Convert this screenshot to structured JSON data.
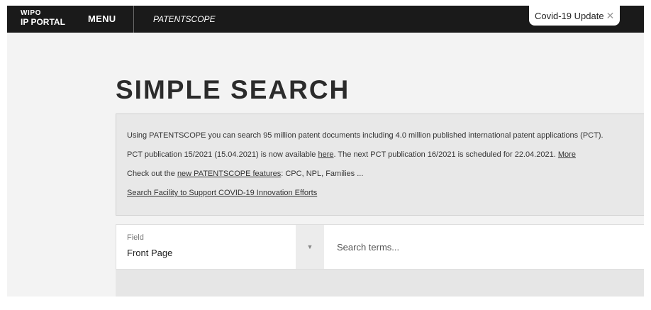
{
  "header": {
    "logo_line1": "WIPO",
    "logo_line2": "IP PORTAL",
    "menu_label": "MENU",
    "product_name": "PATENTSCOPE",
    "covid_label": "Covid-19 Update",
    "close_glyph": "✕"
  },
  "main": {
    "title": "SIMPLE SEARCH",
    "info": {
      "line1": "Using PATENTSCOPE you can search 95 million patent documents including 4.0 million published international patent applications (PCT).",
      "line2_prefix": "PCT publication 15/2021 (15.04.2021) is now available ",
      "line2_link": "here",
      "line2_suffix": ". The next PCT publication 16/2021 is scheduled for 22.04.2021. ",
      "line2_more": "More",
      "line3_prefix": "Check out the ",
      "line3_link": "new PATENTSCOPE features",
      "line3_suffix": ": CPC, NPL, Families ...",
      "line4_link": "Search Facility to Support COVID-19 Innovation Efforts"
    },
    "search": {
      "field_label": "Field",
      "field_value": "Front Page",
      "dropdown_glyph": "▼",
      "placeholder": "Search terms..."
    }
  }
}
